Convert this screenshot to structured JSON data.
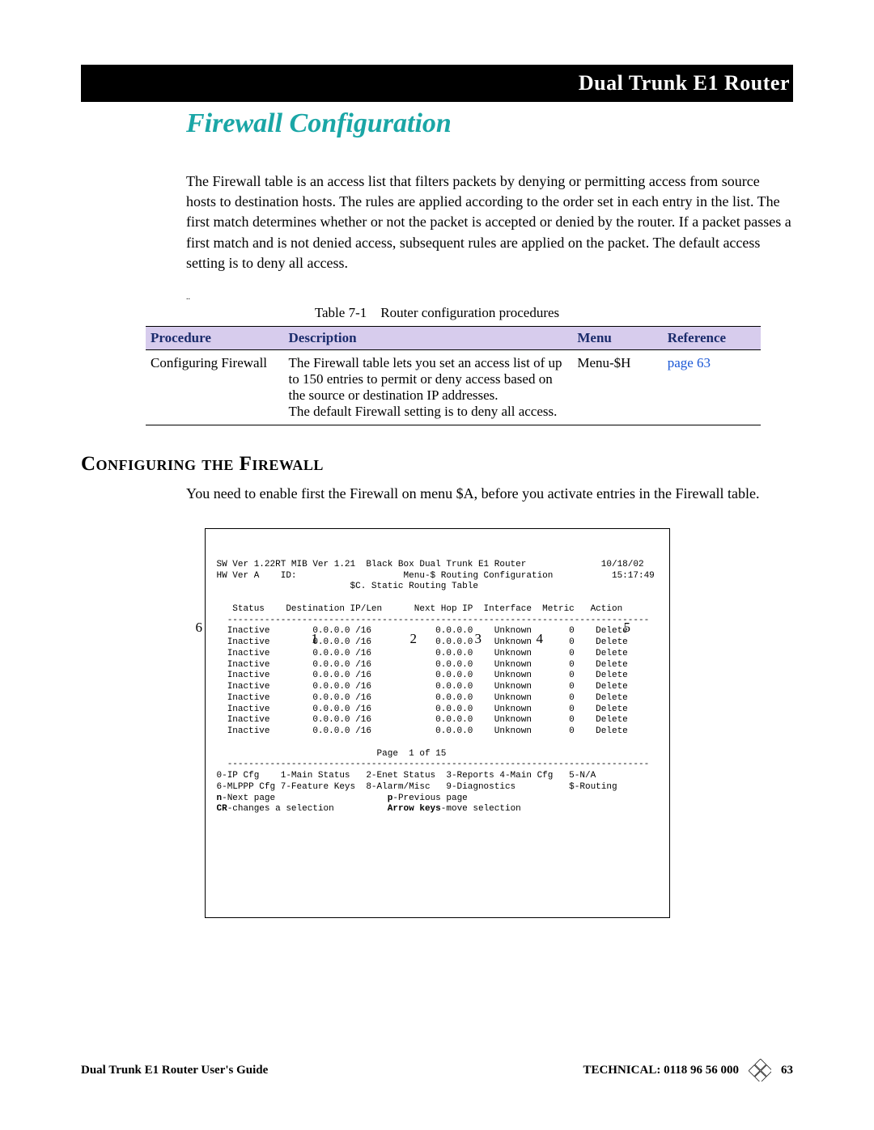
{
  "header": {
    "bar_title": "Dual Trunk E1 Router",
    "chapter_title": "Firewall Configuration"
  },
  "intro_text": "The Firewall table is an access list that filters packets by denying or permitting access from source hosts to destination hosts. The rules are applied according to the order set in each entry in the list. The first match determines whether or not the packet is accepted or denied by the router. If a packet passes a first match and is not denied access, subsequent rules are applied on the packet. The default access setting is to deny all access.",
  "table": {
    "caption": "Table 7-1 Router configuration procedures",
    "headers": {
      "c1": "Procedure",
      "c2": "Description",
      "c3": "Menu",
      "c4": "Reference"
    },
    "row": {
      "procedure": "Configuring Firewall",
      "description": "The Firewall table lets you set an access list of up to 150 entries to permit or deny access based on the source or destination IP addresses.\nThe default Firewall setting is to deny all access.",
      "menu": "Menu-$H",
      "reference": "page 63"
    }
  },
  "section": {
    "heading": "Configuring the Firewall",
    "lead": "You need to enable first the Firewall on menu $A, before you activate entries in the Firewall table."
  },
  "terminal": {
    "line1": "SW Ver 1.22RT MIB Ver 1.21  Black Box Dual Trunk E1 Router              10/18/02",
    "line2": "HW Ver A    ID:                    Menu-$ Routing Configuration           15:17:49",
    "line3": "                         $C. Static Routing Table",
    "colhdr": "   Status    Destination IP/Len      Next Hop IP  Interface  Metric   Action",
    "rule": "  -------------------------------------------------------------------------------",
    "rows": [
      "  Inactive        0.0.0.0 /16            0.0.0.0    Unknown       0    Delete",
      "  Inactive        0.0.0.0 /16            0.0.0.0    Unknown       0    Delete",
      "  Inactive        0.0.0.0 /16            0.0.0.0    Unknown       0    Delete",
      "  Inactive        0.0.0.0 /16            0.0.0.0    Unknown       0    Delete",
      "  Inactive        0.0.0.0 /16            0.0.0.0    Unknown       0    Delete",
      "  Inactive        0.0.0.0 /16            0.0.0.0    Unknown       0    Delete",
      "  Inactive        0.0.0.0 /16            0.0.0.0    Unknown       0    Delete",
      "  Inactive        0.0.0.0 /16            0.0.0.0    Unknown       0    Delete",
      "  Inactive        0.0.0.0 /16            0.0.0.0    Unknown       0    Delete",
      "  Inactive        0.0.0.0 /16            0.0.0.0    Unknown       0    Delete"
    ],
    "pager": "                              Page  1 of 15",
    "menubar1": "0-IP Cfg    1-Main Status   2-Enet Status  3-Reports 4-Main Cfg   5-N/A",
    "menubar2": "6-MLPPP Cfg 7-Feature Keys  8-Alarm/Misc   9-Diagnostics          $-Routing",
    "hint1": "n-Next page                     p-Previous page",
    "hint2": "CR-changes a selection          Arrow keys-move selection",
    "overlays": {
      "n6": "6",
      "n1": "1",
      "n2": "2",
      "n3": "3",
      "n4": "4",
      "n5": "5"
    }
  },
  "footer": {
    "left": "Dual Trunk E1 Router User's Guide",
    "center": "TECHNICAL: 0118 96 56 000",
    "page": "63"
  }
}
